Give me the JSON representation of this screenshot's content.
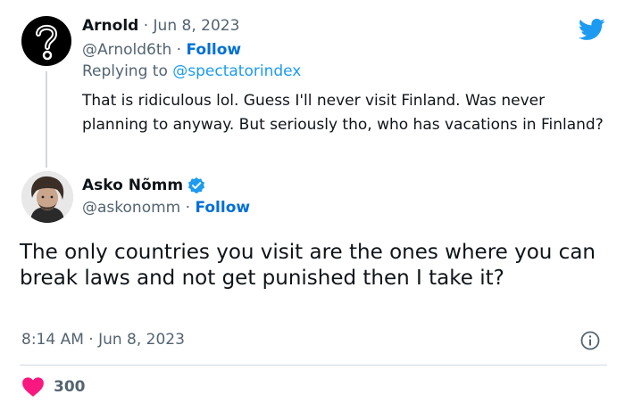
{
  "colors": {
    "twitter_blue": "#1d9bf0",
    "follow_blue": "#006fd6",
    "heart": "#f91880",
    "muted": "#536471"
  },
  "reply_tweet": {
    "name": "Arnold",
    "separator": "·",
    "date": "Jun 8, 2023",
    "handle": "@Arnold6th",
    "follow_label": "Follow",
    "replying_prefix": "Replying to",
    "replying_to": "@spectatorindex",
    "text": "That is ridiculous lol. Guess I'll never visit Finland. Was never planning to anyway. But seriously tho, who has vacations in Finland?",
    "avatar_icon": "question-mark-icon"
  },
  "main_tweet": {
    "name": "Asko Nõmm",
    "verified_icon": "verified-badge-icon",
    "handle": "@askonomm",
    "separator": "·",
    "follow_label": "Follow",
    "text": "The only countries you visit are the ones where you can break laws and not get punished then I take it?",
    "time": "8:14 AM · Jun 8, 2023",
    "likes": "300"
  },
  "icons": {
    "brand": "twitter-bird-icon",
    "info": "info-icon",
    "like": "heart-icon"
  }
}
